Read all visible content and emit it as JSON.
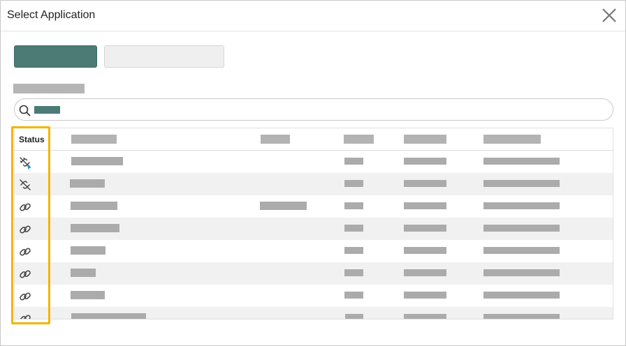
{
  "window": {
    "title": "Select Application",
    "close_icon": "close-icon"
  },
  "toolbar": {
    "primary_color": "#4c7b76",
    "secondary_color": "#efefef"
  },
  "search": {
    "icon": "search-icon",
    "placeholder": ""
  },
  "table": {
    "columns": [
      {
        "label": "Status"
      }
    ],
    "row_count": 8,
    "status_icons": [
      "plug-disconnected-upload-icon",
      "plug-disconnected-icon",
      "link-icon",
      "link-icon",
      "link-icon",
      "link-icon",
      "link-icon",
      "link-icon"
    ]
  },
  "highlight_color": "#f5b400"
}
